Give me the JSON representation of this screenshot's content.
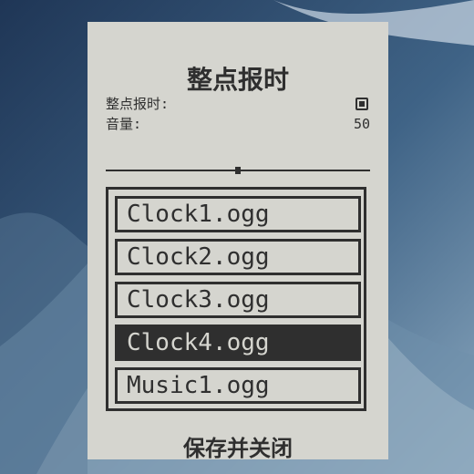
{
  "window": {
    "title": "整点报时"
  },
  "settings": {
    "chime_label": "整点报时:",
    "chime_enabled": true,
    "volume_label": "音量:",
    "volume_value": "50",
    "volume_percent": 50
  },
  "files": [
    {
      "name": "Clock1.ogg",
      "selected": false
    },
    {
      "name": "Clock2.ogg",
      "selected": false
    },
    {
      "name": "Clock3.ogg",
      "selected": false
    },
    {
      "name": "Clock4.ogg",
      "selected": true
    },
    {
      "name": "Music1.ogg",
      "selected": false
    }
  ],
  "actions": {
    "save_close_label": "保存并关闭"
  },
  "colors": {
    "panel": "#d5d5cf",
    "ink": "#2f2f2f",
    "wallpaper": "#2f4f74"
  }
}
